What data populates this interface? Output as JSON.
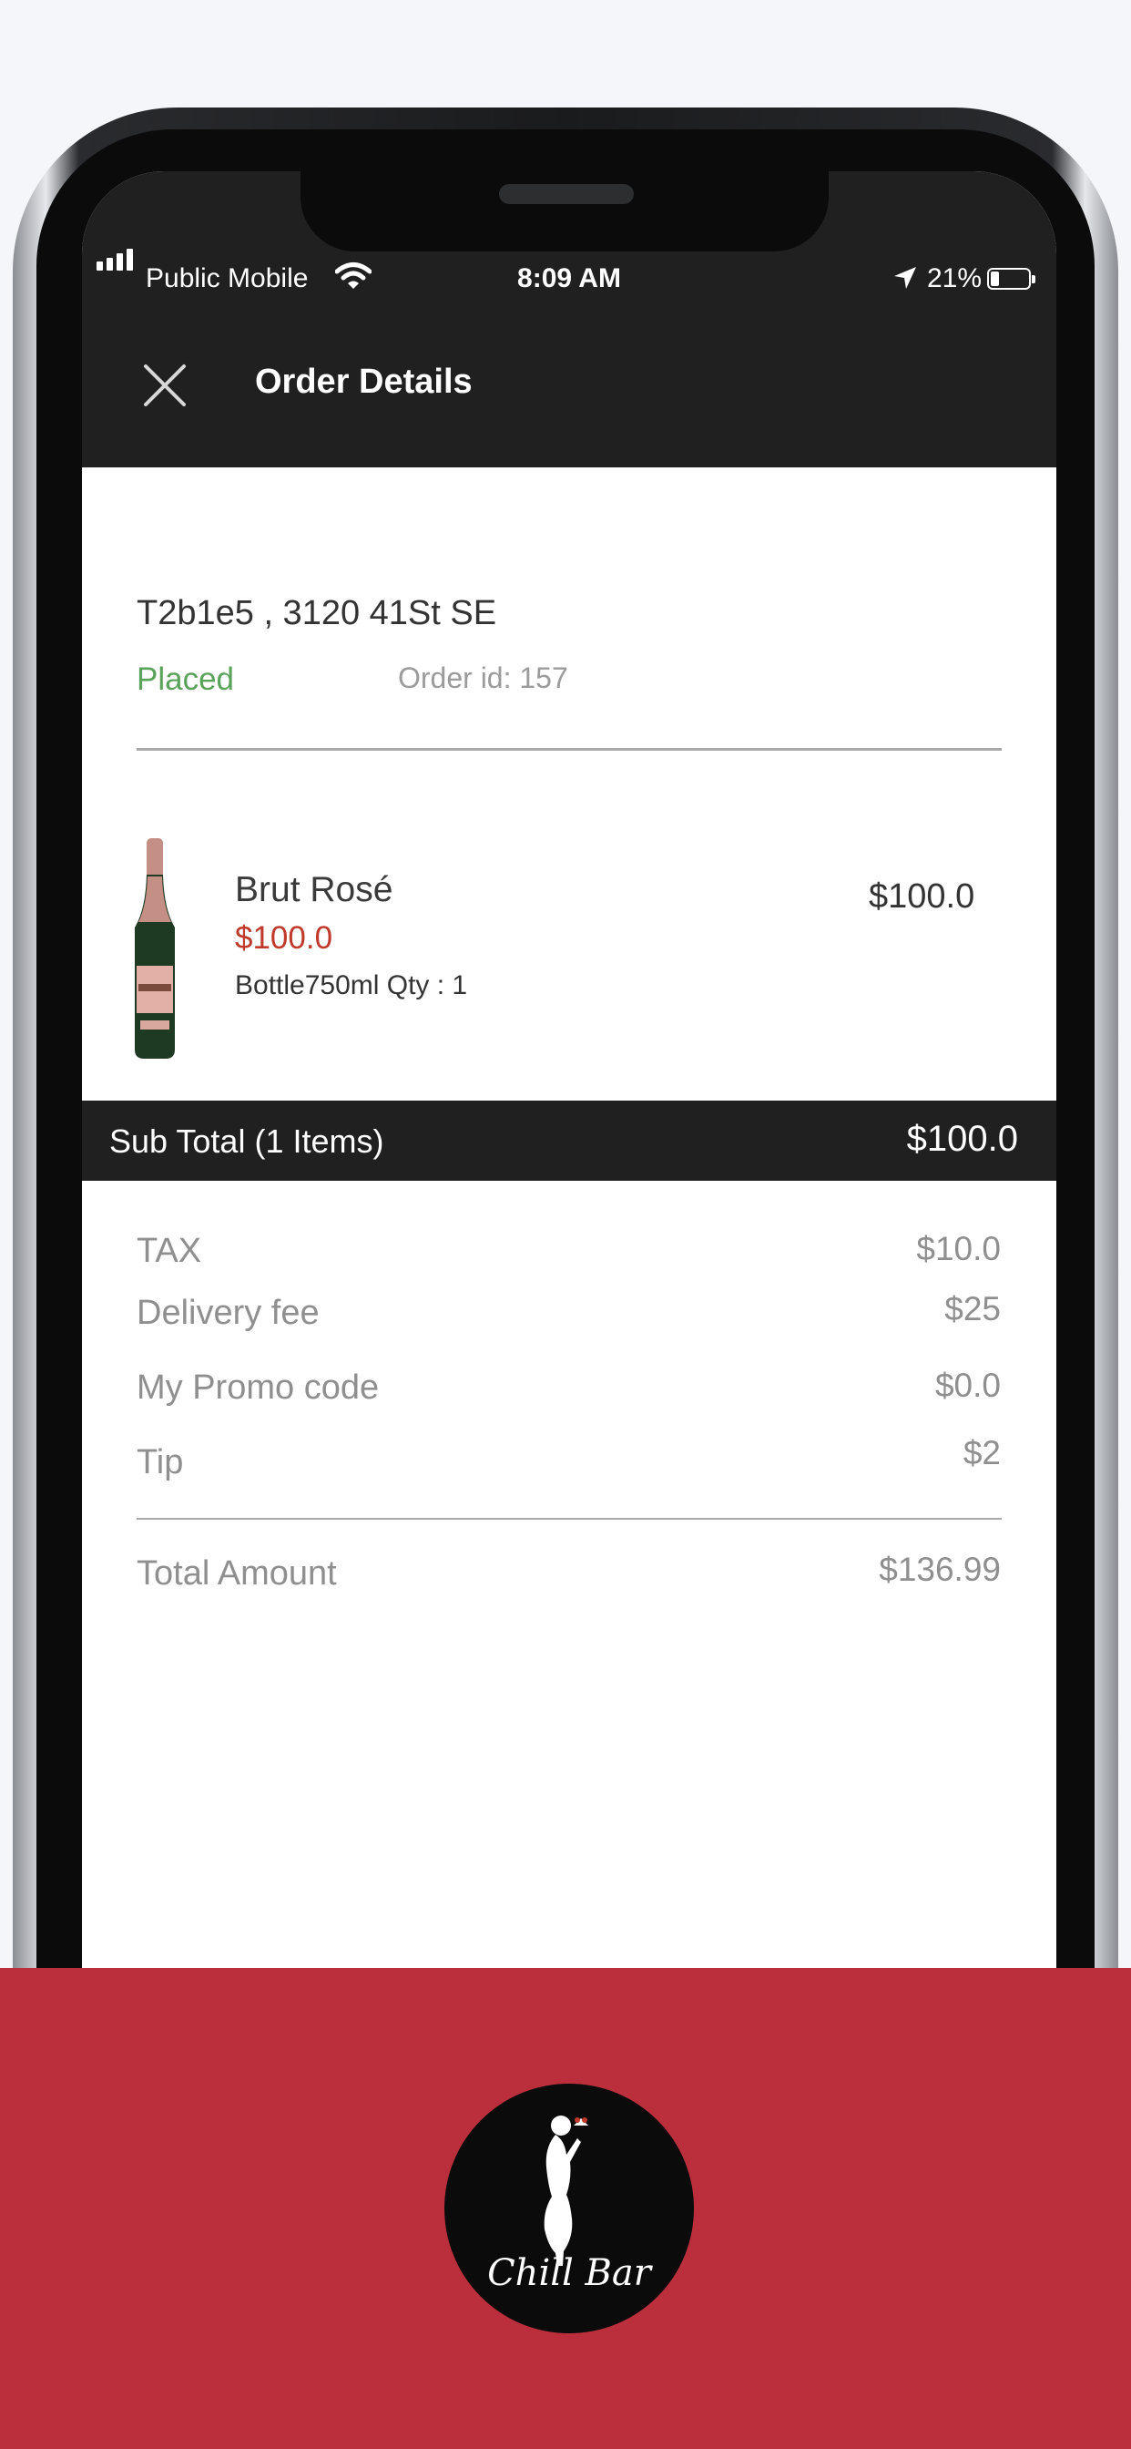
{
  "status_bar": {
    "carrier": "Public Mobile",
    "time": "8:09 AM",
    "battery": "21%"
  },
  "header": {
    "title": "Order Details"
  },
  "order": {
    "address": "T2b1e5 , 3120 41St SE",
    "status": "Placed",
    "order_id": "Order id: 157"
  },
  "item": {
    "name": "Brut Rosé",
    "price": "$100.0",
    "details": "Bottle750ml Qty : 1",
    "line_total": "$100.0"
  },
  "subtotal": {
    "label": "Sub Total (1 Items)",
    "value": "$100.0"
  },
  "charges": [
    {
      "label": "TAX",
      "value": "$10.0"
    },
    {
      "label": "Delivery fee",
      "value": "$25"
    },
    {
      "label": "My Promo code",
      "value": "$0.0"
    },
    {
      "label": "Tip",
      "value": "$2"
    }
  ],
  "total": {
    "label": "Total Amount",
    "value": "$136.99"
  },
  "brand": {
    "logo_text": "Chill Bar"
  },
  "colors": {
    "accent_red": "#bb2f3d",
    "status_green": "#5aa35a",
    "price_red": "#c0392b",
    "header_dark": "#202020"
  }
}
